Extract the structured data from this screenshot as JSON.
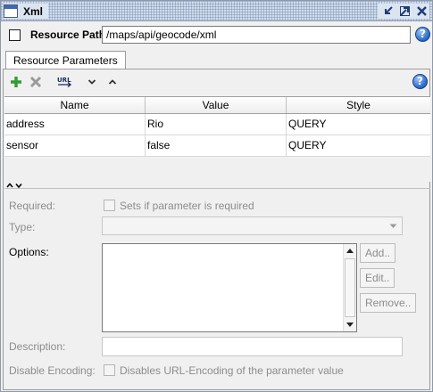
{
  "window": {
    "title": "Xml",
    "buttons": [
      "minimize-icon",
      "restore-icon",
      "close-icon"
    ]
  },
  "resource_path": {
    "label": "Resource Path",
    "value": "/maps/api/geocode/xml",
    "checkbox_checked": false
  },
  "tabs": [
    {
      "label": "Resource Parameters",
      "active": true
    }
  ],
  "toolbar": {
    "items": [
      "add-icon",
      "remove-icon",
      "url-icon",
      "move-down-icon",
      "move-up-icon",
      "help-icon"
    ],
    "url_icon_text": "URL"
  },
  "table": {
    "columns": [
      "Name",
      "Value",
      "Style"
    ],
    "rows": [
      {
        "name": "address",
        "value": "Rio",
        "style": "QUERY"
      },
      {
        "name": "sensor",
        "value": "false",
        "style": "QUERY"
      }
    ]
  },
  "form": {
    "required_label": "Required:",
    "required_text": "Sets if parameter is required",
    "type_label": "Type:",
    "options_label": "Options:",
    "add_button": "Add..",
    "edit_button": "Edit..",
    "remove_button": "Remove..",
    "description_label": "Description:",
    "disable_encoding_label": "Disable Encoding:",
    "disable_encoding_text": "Disables URL-Encoding of the parameter value"
  },
  "help_glyph": "?",
  "colors": {
    "add_green": "#2e9e33",
    "remove_gray": "#9a9a9a",
    "help_blue": "#2d6fd0",
    "titlebar": "#cfdcec"
  }
}
